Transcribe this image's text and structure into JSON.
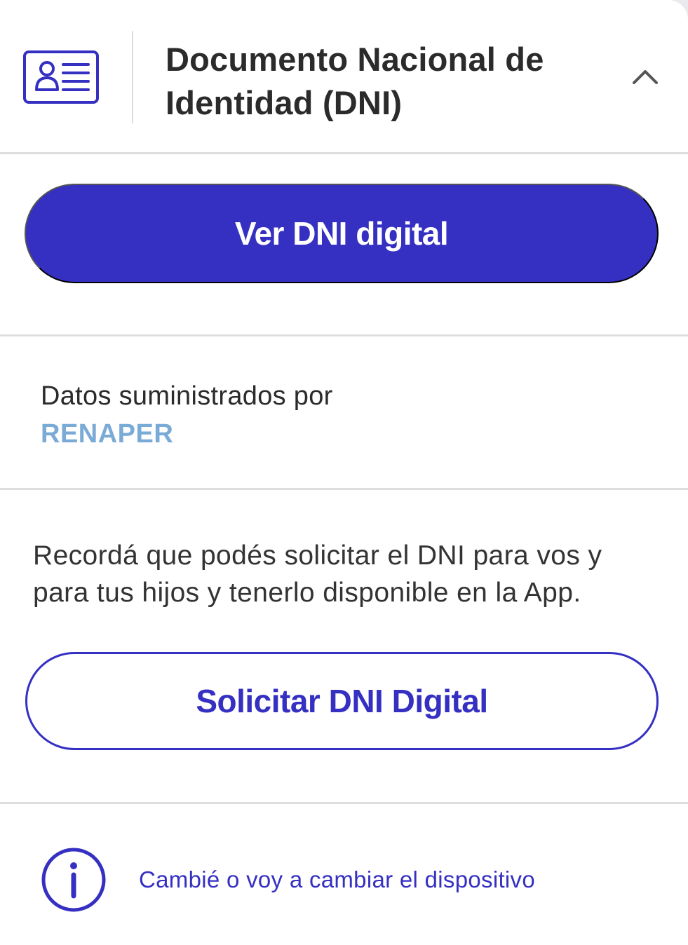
{
  "header": {
    "title": "Documento Nacional de Identidad (DNI)",
    "icon": "id-card-icon",
    "toggle_icon": "chevron-up-icon"
  },
  "actions": {
    "view_label": "Ver DNI digital",
    "request_label": "Solicitar DNI Digital"
  },
  "provider": {
    "label": "Datos suministrados por",
    "name": "RENAPER"
  },
  "reminder": {
    "text": "Recordá que podés solicitar el DNI para vos y para tus hijos y tenerlo disponible en la App."
  },
  "device_change": {
    "icon": "info-icon",
    "label": "Cambié o voy a cambiar el dispositivo"
  },
  "colors": {
    "brand": "#3530c2",
    "provider_link": "#7aaad6",
    "text": "#2b2b2b",
    "divider": "#dedede"
  }
}
